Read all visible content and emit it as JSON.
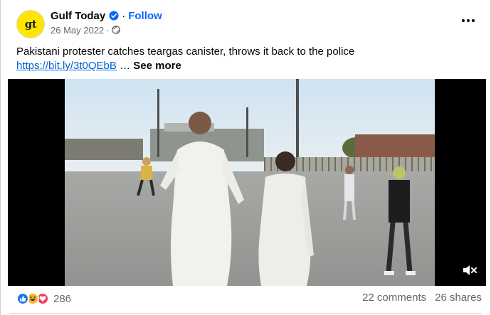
{
  "header": {
    "avatar_text": "gt",
    "page_name": "Gulf Today",
    "separator": "·",
    "follow_label": "Follow",
    "date": "26 May 2022",
    "meta_separator": "·",
    "privacy_icon": "globe-icon",
    "more_icon": "more-options-icon"
  },
  "post": {
    "text": "Pakistani protester catches teargas canister, throws it back to the police",
    "link": "https://bit.ly/3t0QEbB",
    "ellipsis": " … ",
    "see_more": "See more"
  },
  "video": {
    "mute_icon": "mute-icon"
  },
  "footer": {
    "reactions": [
      "like-reaction-icon",
      "haha-reaction-icon",
      "love-reaction-icon"
    ],
    "reaction_count": "286",
    "comments": "22 comments",
    "shares": "26 shares"
  },
  "colors": {
    "accent": "#0866ff",
    "link": "#0064d1",
    "secondary_text": "#65676b",
    "avatar_bg": "#ffe600"
  }
}
